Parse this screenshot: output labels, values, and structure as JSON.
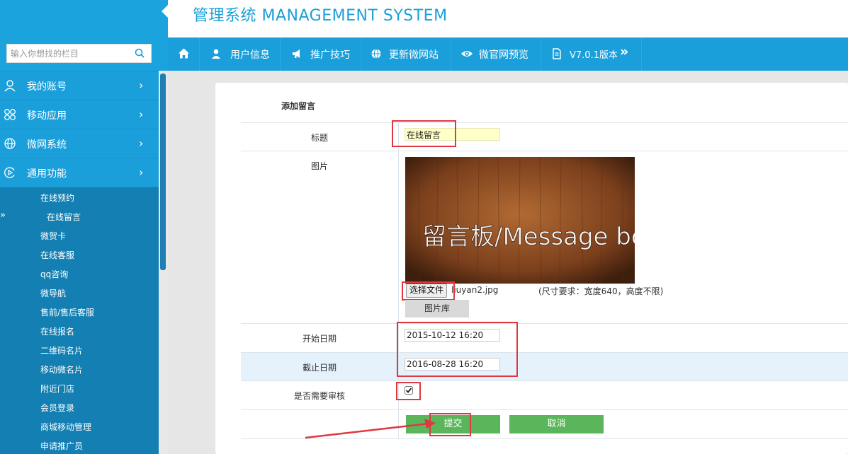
{
  "header": {
    "title": "管理系统 MANAGEMENT SYSTEM"
  },
  "search": {
    "placeholder": "输入你想找的栏目"
  },
  "nav": {
    "items": [
      {
        "label": "",
        "icon": "home-icon"
      },
      {
        "label": "用户信息",
        "icon": "user-icon"
      },
      {
        "label": "推广技巧",
        "icon": "megaphone-icon"
      },
      {
        "label": "更新微网站",
        "icon": "globe-icon"
      },
      {
        "label": "微官网预览",
        "icon": "eye-icon"
      },
      {
        "label": "V7.0.1版本",
        "icon": "document-icon",
        "suffix": "»"
      }
    ]
  },
  "sidebar": {
    "menus": [
      {
        "label": "我的账号",
        "icon": "user-outline-icon"
      },
      {
        "label": "移动应用",
        "icon": "apps-icon"
      },
      {
        "label": "微网系统",
        "icon": "globe-icon"
      },
      {
        "label": "通用功能",
        "icon": "play-circle-icon"
      }
    ],
    "chevron": "›",
    "active_marker": "»",
    "sub_items": [
      "在线预约",
      "在线留言",
      "微贺卡",
      "在线客服",
      "qq咨询",
      "微导航",
      "售前/售后客服",
      "在线报名",
      "二维码名片",
      "移动微名片",
      "附近门店",
      "会员登录",
      "商城移动管理",
      "申请推广员"
    ],
    "active_sub": "在线留言"
  },
  "form": {
    "section_title": "添加留言",
    "title_label": "标题",
    "title_value": "在线留言",
    "image_label": "图片",
    "image_text": "留言板/Message boards",
    "file_button": "选择文件",
    "file_name": "liuyan2.jpg",
    "size_hint": "(尺寸要求：宽度640，高度不限)",
    "gallery_button": "图片库",
    "start_label": "开始日期",
    "start_value": "2015-10-12 16:20",
    "end_label": "截止日期",
    "end_value": "2016-08-28 16:20",
    "review_label": "是否需要审核",
    "review_checked": true,
    "submit_button": "提交",
    "cancel_button": "取消"
  },
  "colors": {
    "brand": "#1b9fda",
    "highlight": "#e0383e",
    "button_green": "#5bb65b",
    "title_input_bg": "#ffffc8"
  }
}
